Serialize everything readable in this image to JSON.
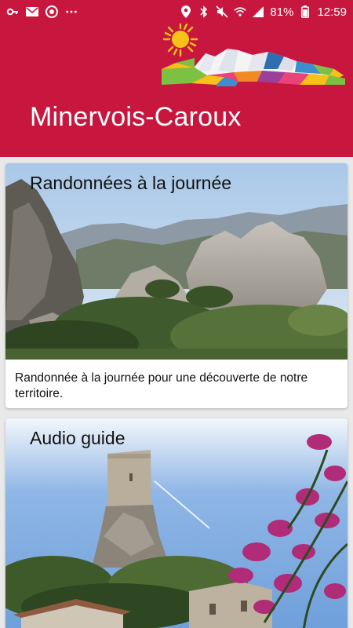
{
  "status_bar": {
    "battery_percent": "81%",
    "time": "12:59",
    "icons_left": [
      "key-icon",
      "mail-icon",
      "chat-icon",
      "more-icon"
    ],
    "icons_right": [
      "location-icon",
      "bluetooth-icon",
      "mute-icon",
      "wifi-icon",
      "signal-icon",
      "battery-icon"
    ]
  },
  "header": {
    "title": "Minervois-Caroux",
    "accent_color": "#c8173f"
  },
  "cards": [
    {
      "title": "Randonnées à la journée",
      "description": "Randonnée à la journée pour une découverte de notre territoire."
    },
    {
      "title": "Audio guide"
    }
  ]
}
